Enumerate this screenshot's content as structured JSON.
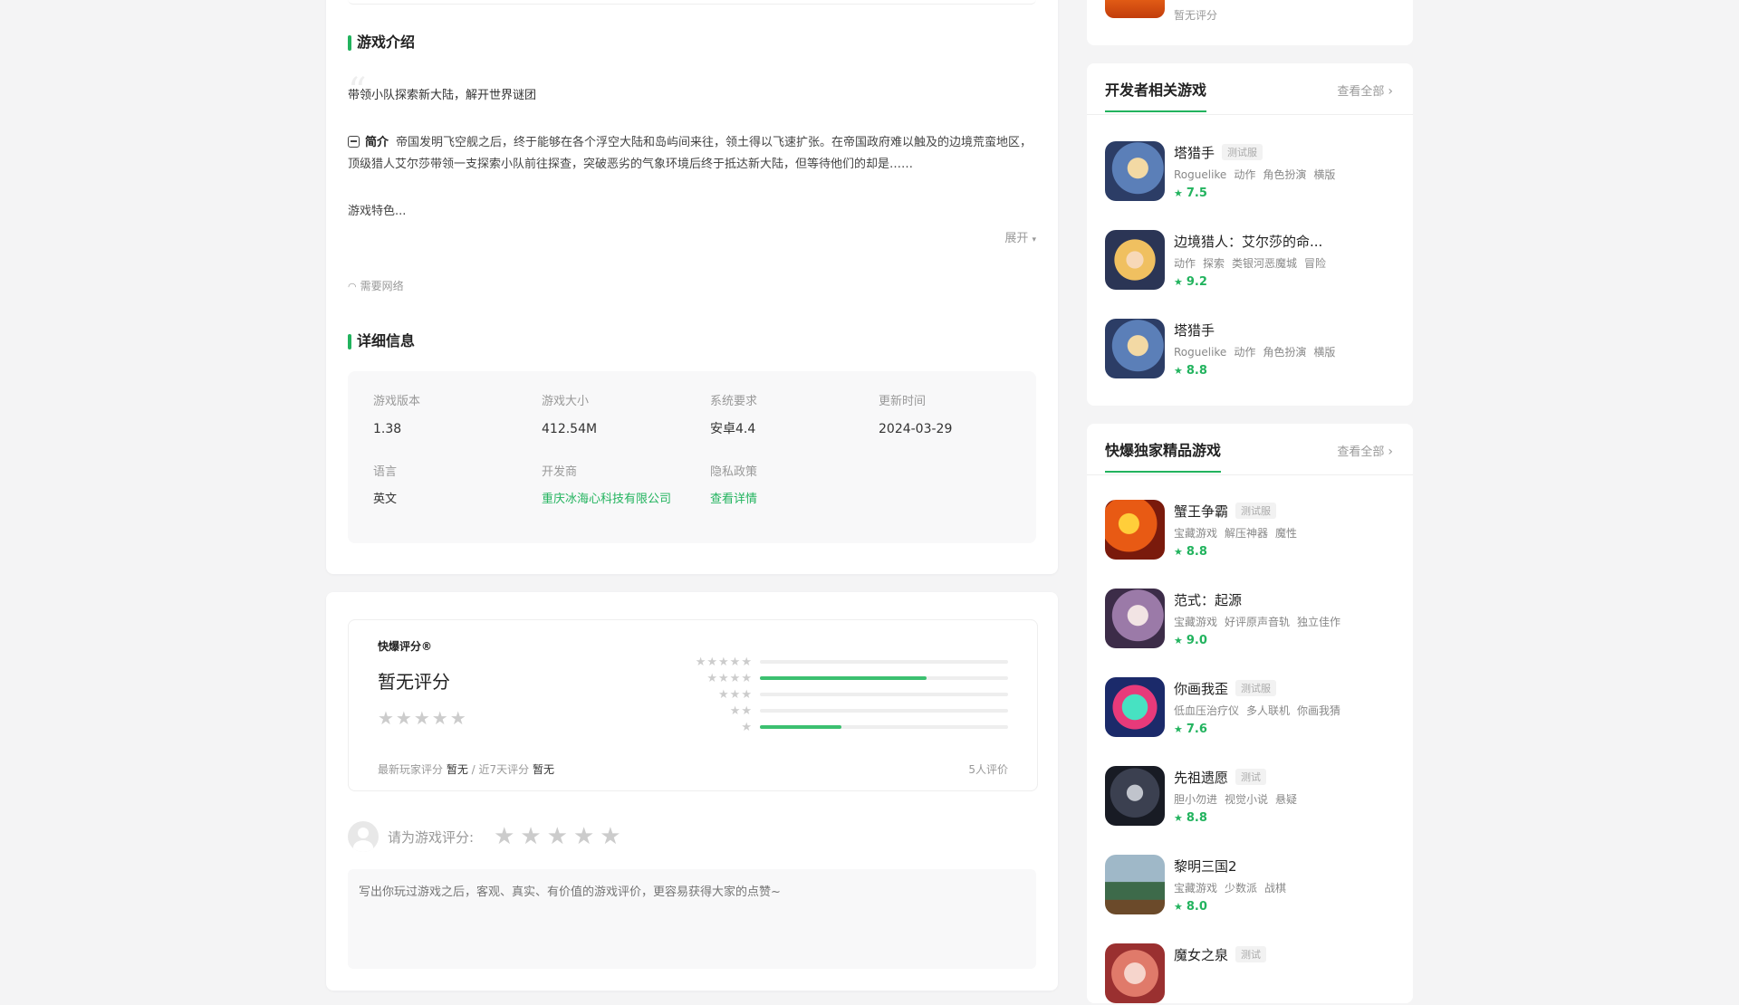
{
  "intro": {
    "title": "游戏介绍",
    "slogan": "带领小队探索新大陆，解开世界谜团",
    "brief_label": "简介",
    "brief_text": "帝国发明飞空舰之后，终于能够在各个浮空大陆和岛屿间来往，领土得以飞速扩张。在帝国政府难以触及的边境荒蛮地区，顶级猎人艾尔莎带领一支探索小队前往探查，突破恶劣的气象环境后终于抵达新大陆，但等待他们的却是……",
    "features": "游戏特色...",
    "expand": "展开",
    "network": "需要网络"
  },
  "details": {
    "title": "详细信息",
    "items": [
      {
        "label": "游戏版本",
        "value": "1.38"
      },
      {
        "label": "游戏大小",
        "value": "412.54M"
      },
      {
        "label": "系统要求",
        "value": "安卓4.4"
      },
      {
        "label": "更新时间",
        "value": "2024-03-29"
      },
      {
        "label": "语言",
        "value": "英文"
      },
      {
        "label": "开发商",
        "value": "重庆冰海心科技有限公司"
      },
      {
        "label": "隐私政策",
        "value": "查看详情"
      }
    ]
  },
  "rating": {
    "brand": "快爆评分®",
    "score_text": "暂无评分",
    "latest_label": "最新玩家评分",
    "latest_value": "暂无",
    "recent_label": "近7天评分",
    "recent_value": "暂无",
    "count": "5人评价",
    "distribution": [
      {
        "stars": "★★★★★",
        "fraction": 0.0
      },
      {
        "stars": "★★★★",
        "fraction": 0.67
      },
      {
        "stars": "★★★",
        "fraction": 0.0
      },
      {
        "stars": "★★",
        "fraction": 0.0
      },
      {
        "stars": "★",
        "fraction": 0.33
      }
    ],
    "my_rate_label": "请为游戏评分:",
    "comment_placeholder": "写出你玩过游戏之后，客观、真实、有价值的游戏评价，更容易获得大家的点赞~"
  },
  "prev_card": {
    "text": "暂无评分"
  },
  "developer_games": {
    "title": "开发者相关游戏",
    "more": "查看全部",
    "items": [
      {
        "name": "塔猎手",
        "badge": "测试服",
        "tags": [
          "Roguelike",
          "动作",
          "角色扮演",
          "横版"
        ],
        "score": "7.5",
        "icon": "ic-blue"
      },
      {
        "name": "边境猎人：艾尔莎的命...",
        "badge": "",
        "tags": [
          "动作",
          "探索",
          "类银河恶魔城",
          "冒险"
        ],
        "score": "9.2",
        "icon": "ic-blonde"
      },
      {
        "name": "塔猎手",
        "badge": "",
        "tags": [
          "Roguelike",
          "动作",
          "角色扮演",
          "横版"
        ],
        "score": "8.8",
        "icon": "ic-blue"
      }
    ]
  },
  "exclusive_games": {
    "title": "快爆独家精品游戏",
    "more": "查看全部",
    "items": [
      {
        "name": "蟹王争霸",
        "badge": "测试服",
        "tags": [
          "宝藏游戏",
          "解压神器",
          "魔性"
        ],
        "score": "8.8",
        "icon": "ic-crab"
      },
      {
        "name": "范式：起源",
        "badge": "",
        "tags": [
          "宝藏游戏",
          "好评原声音轨",
          "独立佳作"
        ],
        "score": "9.0",
        "icon": "ic-purple"
      },
      {
        "name": "你画我歪",
        "badge": "测试服",
        "tags": [
          "低血压治疗仪",
          "多人联机",
          "你画我猜"
        ],
        "score": "7.6",
        "icon": "ic-smile"
      },
      {
        "name": "先祖遗愿",
        "badge": "测试",
        "tags": [
          "胆小勿进",
          "视觉小说",
          "悬疑"
        ],
        "score": "8.8",
        "icon": "ic-dark"
      },
      {
        "name": "黎明三国2",
        "badge": "",
        "tags": [
          "宝藏游戏",
          "少数派",
          "战棋"
        ],
        "score": "8.0",
        "icon": "ic-castle"
      },
      {
        "name": "魔女之泉",
        "badge": "测试",
        "tags": [],
        "score": "",
        "icon": "ic-pink"
      }
    ]
  }
}
